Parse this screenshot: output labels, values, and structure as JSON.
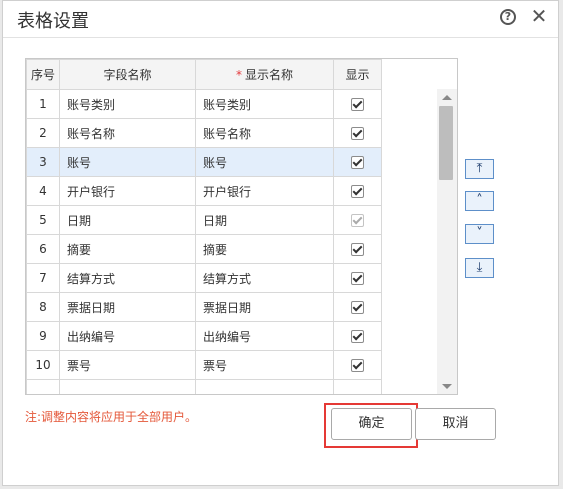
{
  "dialog": {
    "title": "表格设置",
    "help_icon": "question-circle-icon",
    "help_glyph": "?",
    "close_icon": "close-icon",
    "close_glyph": "✕"
  },
  "table": {
    "headers": [
      "序号",
      "字段名称",
      "显示名称",
      "显示"
    ],
    "required_mark": "*",
    "selected_row": 3,
    "rows": [
      {
        "seq": "1",
        "field": "账号类别",
        "display": "账号类别",
        "checked": true,
        "disabled": false
      },
      {
        "seq": "2",
        "field": "账号名称",
        "display": "账号名称",
        "checked": true,
        "disabled": false
      },
      {
        "seq": "3",
        "field": "账号",
        "display": "账号",
        "checked": true,
        "disabled": false
      },
      {
        "seq": "4",
        "field": "开户银行",
        "display": "开户银行",
        "checked": true,
        "disabled": false
      },
      {
        "seq": "5",
        "field": "日期",
        "display": "日期",
        "checked": true,
        "disabled": true
      },
      {
        "seq": "6",
        "field": "摘要",
        "display": "摘要",
        "checked": true,
        "disabled": false
      },
      {
        "seq": "7",
        "field": "结算方式",
        "display": "结算方式",
        "checked": true,
        "disabled": false
      },
      {
        "seq": "8",
        "field": "票据日期",
        "display": "票据日期",
        "checked": true,
        "disabled": false
      },
      {
        "seq": "9",
        "field": "出纳编号",
        "display": "出纳编号",
        "checked": true,
        "disabled": false
      },
      {
        "seq": "10",
        "field": "票号",
        "display": "票号",
        "checked": true,
        "disabled": false
      }
    ]
  },
  "move_buttons": {
    "top": {
      "icon": "move-to-top-icon",
      "glyph": "⤒"
    },
    "up": {
      "icon": "move-up-icon",
      "glyph": "˄"
    },
    "down": {
      "icon": "move-down-icon",
      "glyph": "˅"
    },
    "bottom": {
      "icon": "move-to-bottom-icon",
      "glyph": "⤓"
    }
  },
  "footer": {
    "note": "注:调整内容将应用于全部用户。",
    "confirm_label": "确定",
    "cancel_label": "取消"
  },
  "colors": {
    "selected_row_bg": "#e3eefb",
    "highlight_border": "#e53935",
    "note_text": "#e4583a",
    "move_button_border": "#5d8fc9"
  }
}
